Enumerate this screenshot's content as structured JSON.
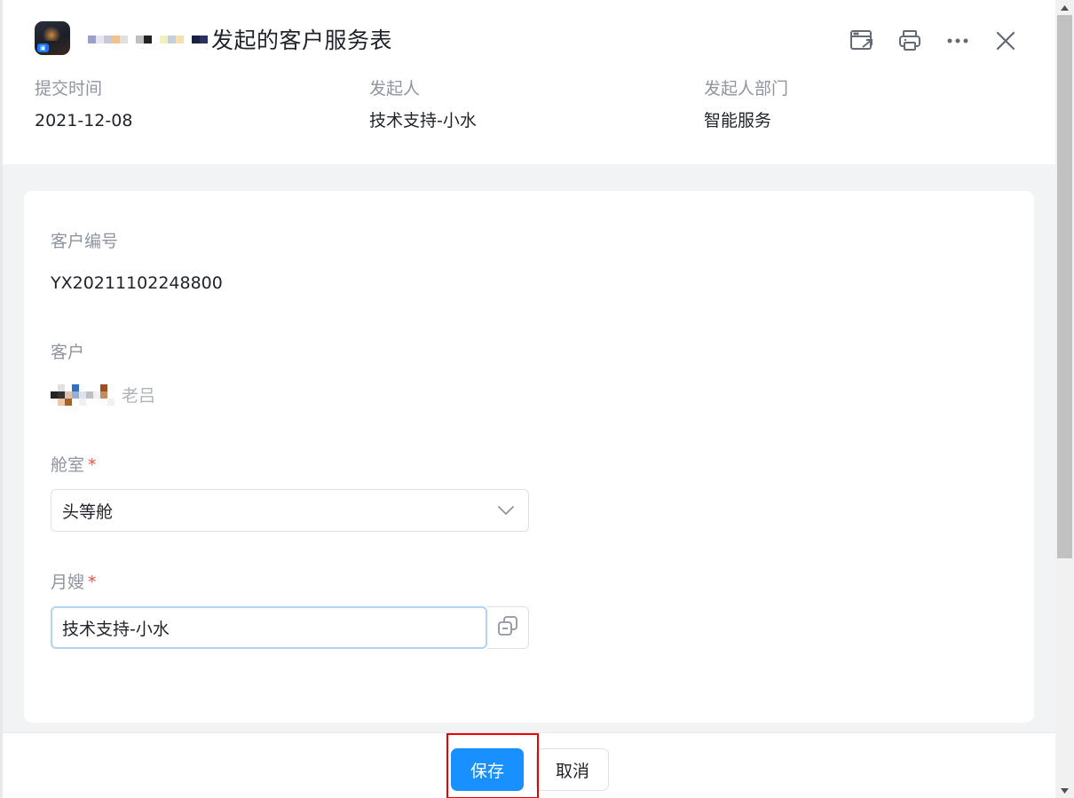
{
  "header": {
    "title_suffix": "发起的客户服务表",
    "tools": [
      "open-window-icon",
      "print-icon",
      "more-icon",
      "close-icon"
    ]
  },
  "meta": {
    "submit_time": {
      "label": "提交时间",
      "value": "2021-12-08"
    },
    "initiator": {
      "label": "发起人",
      "value": "技术支持-小水"
    },
    "department": {
      "label": "发起人部门",
      "value": "智能服务"
    }
  },
  "form": {
    "customer_no": {
      "label": "客户编号",
      "value": "YX20211102248800"
    },
    "customer": {
      "label": "客户",
      "value_visible": "老吕"
    },
    "cabin": {
      "label": "舱室",
      "required_mark": "*",
      "value": "头等舱"
    },
    "nanny": {
      "label": "月嫂",
      "required_mark": "*",
      "value": "技术支持-小水"
    }
  },
  "footer": {
    "save_label": "保存",
    "cancel_label": "取消"
  },
  "colors": {
    "primary": "#1890ff",
    "required": "#f54a45",
    "highlight": "#ee0000",
    "label": "#8f959e"
  }
}
